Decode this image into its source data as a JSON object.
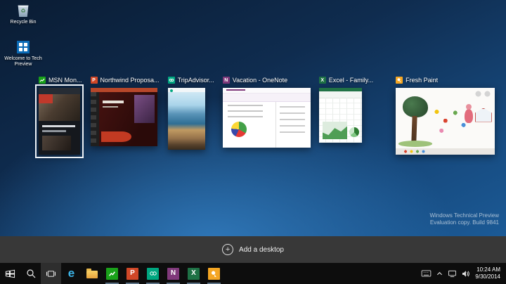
{
  "desktop": {
    "icons": [
      {
        "label": "Recycle Bin"
      },
      {
        "label": "Welcome to Tech Preview"
      }
    ],
    "watermark": {
      "line1": "Windows Technical Preview",
      "line2": "Evaluation copy. Build 9841"
    }
  },
  "task_view": {
    "windows": [
      {
        "title": "MSN Mon...",
        "app": "msn-money",
        "selected": true
      },
      {
        "title": "Northwind Proposa...",
        "app": "powerpoint",
        "selected": false
      },
      {
        "title": "TripAdvisor...",
        "app": "tripadvisor",
        "selected": false
      },
      {
        "title": "Vacation - OneNote",
        "app": "onenote",
        "selected": false
      },
      {
        "title": "Excel - Family...",
        "app": "excel",
        "selected": false
      },
      {
        "title": "Fresh Paint",
        "app": "fresh-paint",
        "selected": false
      }
    ]
  },
  "add_desktop": {
    "label": "Add a desktop"
  },
  "taskbar": {
    "ie_glyph": "e",
    "apps": [
      {
        "name": "msn-money",
        "glyph": "",
        "color": "#1aa11a",
        "running": true
      },
      {
        "name": "powerpoint",
        "glyph": "P",
        "color": "#d04727",
        "running": true
      },
      {
        "name": "tripadvisor",
        "glyph": "",
        "color": "#00a680",
        "running": true
      },
      {
        "name": "onenote",
        "glyph": "N",
        "color": "#80397b",
        "running": true
      },
      {
        "name": "excel",
        "glyph": "X",
        "color": "#1e7145",
        "running": true
      },
      {
        "name": "fresh-paint",
        "glyph": "",
        "color": "#f5a623",
        "running": true
      }
    ],
    "clock": {
      "time": "10:24 AM",
      "date": "9/30/2014"
    }
  },
  "colors": {
    "desktop_top": "#0a1c33",
    "desktop_bottom": "#1b5a96",
    "add_bar": "#383838",
    "taskbar": "#0d0d0d",
    "selection_outline": "#edf2f7"
  }
}
